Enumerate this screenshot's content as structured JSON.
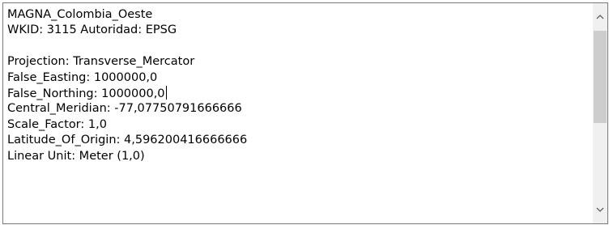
{
  "textbox": {
    "lines": [
      "MAGNA_Colombia_Oeste",
      "WKID: 3115 Autoridad: EPSG",
      "",
      "Projection: Transverse_Mercator",
      "False_Easting: 1000000,0",
      "False_Northing: 1000000,0",
      "Central_Meridian: -77,07750791666666",
      "Scale_Factor: 1,0",
      "Latitude_Of_Origin: 4,596200416666666",
      "Linear Unit: Meter (1,0)"
    ]
  },
  "scrollbar": {
    "up_icon": "chevron-up-icon",
    "down_icon": "chevron-down-icon",
    "thumb_color": "#cdcdcd",
    "track_color": "#f0f0f0"
  }
}
